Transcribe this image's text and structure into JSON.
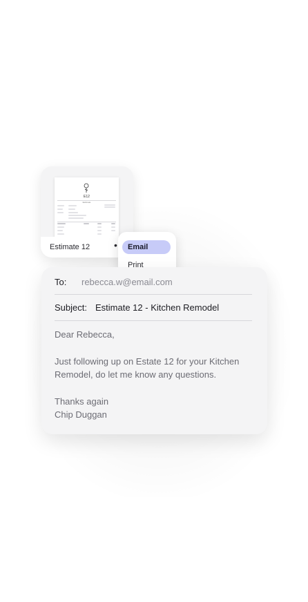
{
  "document": {
    "name": "Estimate 12",
    "menu_dots": "•",
    "thumbnail_heading": "E12",
    "thumbnail_subheading": "Estimate"
  },
  "menu": {
    "items": [
      {
        "label": "Email",
        "active": true
      },
      {
        "label": "Print",
        "active": false
      }
    ]
  },
  "email": {
    "to_label": "To:",
    "to_value": "rebecca.w@email.com",
    "subject_label": "Subject:",
    "subject_value": "Estimate 12 - Kitchen Remodel",
    "greeting": "Dear Rebecca,",
    "message": "Just following up on Estate 12 for your Kitchen\nRemodel, do let me know any questions.",
    "signoff": "Thanks again\nChip Duggan"
  },
  "colors": {
    "active_menu": "#c7cbf8",
    "card_bg": "#f4f4f5"
  }
}
